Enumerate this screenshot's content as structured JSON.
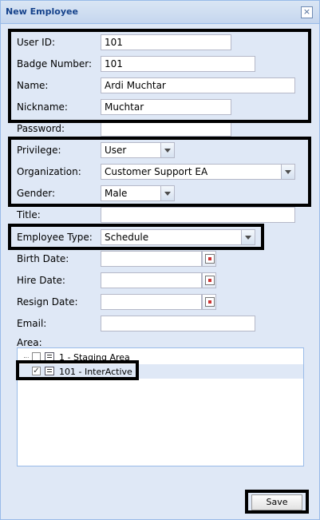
{
  "window": {
    "title": "New Employee",
    "close_icon": "close-icon"
  },
  "fields": {
    "user_id": {
      "label": "User ID:",
      "value": "101"
    },
    "badge_number": {
      "label": "Badge Number:",
      "value": "101"
    },
    "name": {
      "label": "Name:",
      "value": "Ardi Muchtar"
    },
    "nickname": {
      "label": "Nickname:",
      "value": "Muchtar"
    },
    "password": {
      "label": "Password:",
      "value": ""
    },
    "privilege": {
      "label": "Privilege:",
      "value": "User"
    },
    "organization": {
      "label": "Organization:",
      "value": "Customer Support EA"
    },
    "gender": {
      "label": "Gender:",
      "value": "Male"
    },
    "title": {
      "label": "Title:",
      "value": ""
    },
    "employee_type": {
      "label": "Employee Type:",
      "value": "Schedule"
    },
    "birth_date": {
      "label": "Birth Date:",
      "value": ""
    },
    "hire_date": {
      "label": "Hire Date:",
      "value": ""
    },
    "resign_date": {
      "label": "Resign Date:",
      "value": ""
    },
    "email": {
      "label": "Email:",
      "value": ""
    },
    "area": {
      "label": "Area:",
      "items": [
        {
          "text": "1 - Staging Area",
          "checked": false
        },
        {
          "text": "101 - InterActive",
          "checked": true
        }
      ]
    }
  },
  "actions": {
    "save_label": "Save"
  },
  "colors": {
    "accent": "#15428b",
    "panel": "#dfe8f6",
    "highlight": "#000000"
  }
}
